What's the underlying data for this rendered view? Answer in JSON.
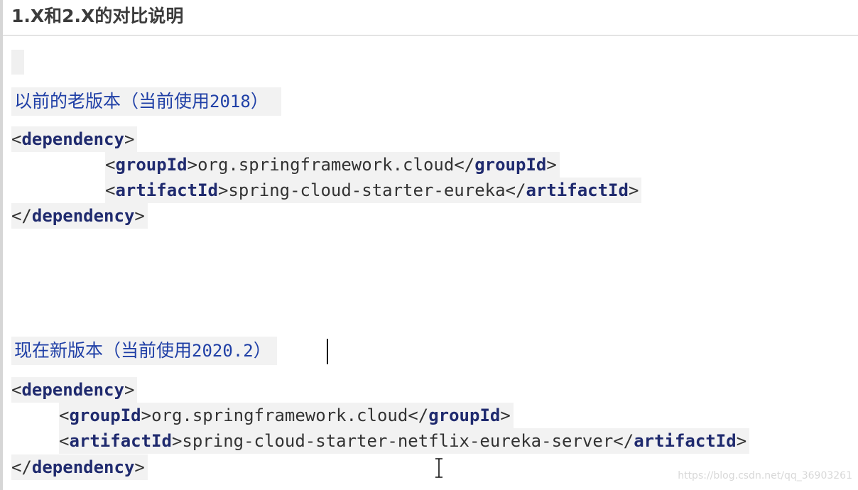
{
  "document": {
    "title": "1.X和2.X的对比说明"
  },
  "old_version": {
    "heading_prefix": "以前的老版本（当前使用",
    "heading_number": "2018",
    "heading_suffix": "）",
    "code": {
      "dependency_open": "dependency",
      "group_tag": "groupId",
      "group_value": "org.springframework.cloud",
      "artifact_tag": "artifactId",
      "artifact_value": "spring-cloud-starter-eureka",
      "dependency_close": "dependency"
    }
  },
  "new_version": {
    "heading_prefix": "现在新版本（当前使用",
    "heading_number": "2020.2",
    "heading_suffix": "）",
    "code": {
      "dependency_open": "dependency",
      "group_tag": "groupId",
      "group_value": "org.springframework.cloud",
      "artifact_tag": "artifactId",
      "artifact_value": "spring-cloud-starter-netflix-eureka-server",
      "dependency_close": "dependency"
    }
  },
  "watermark": "https://blog.csdn.net/qq_36903261",
  "colors": {
    "heading_text": "#1f3fa6",
    "xml_tag": "#1f2a6e",
    "code_background": "#f2f2f2"
  }
}
